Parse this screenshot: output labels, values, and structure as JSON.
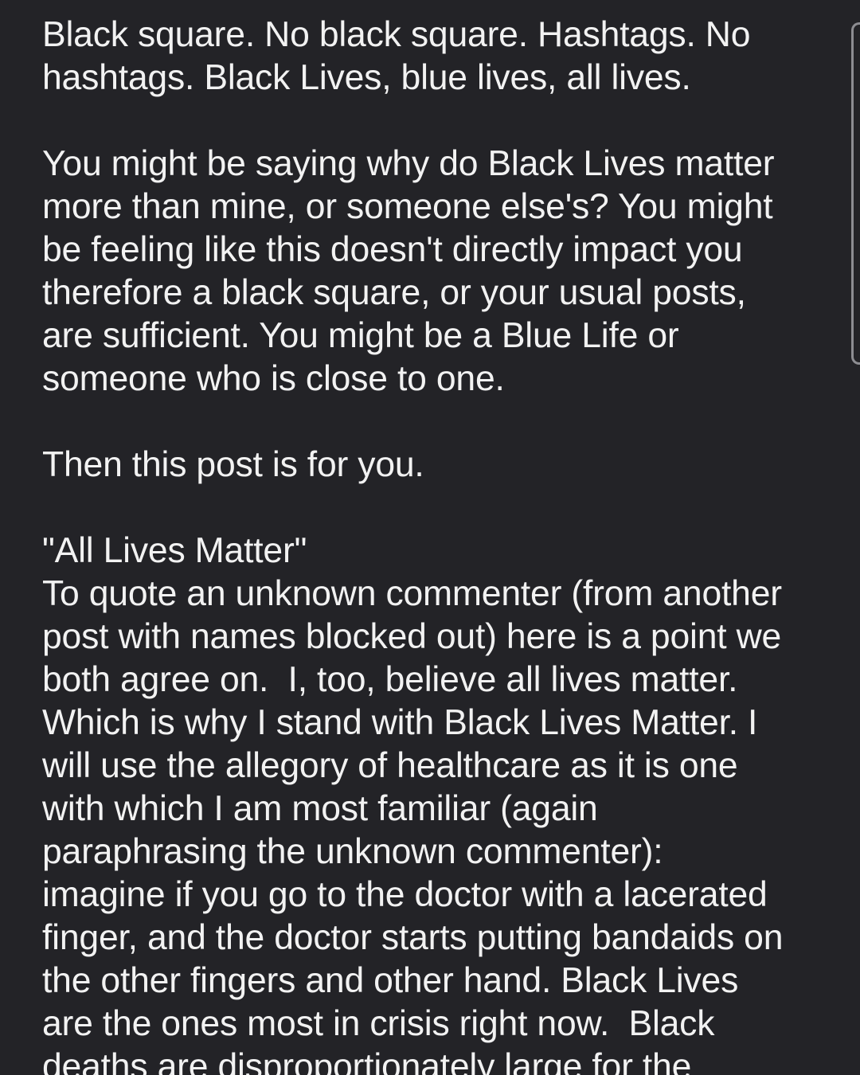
{
  "post": {
    "paragraphs": [
      {
        "lines": [
          "Black square. No black square. Hashtags. No",
          "hashtags. Black Lives, blue lives, all lives."
        ]
      },
      {
        "lines": [
          "You might be saying why do Black Lives matter",
          "more than mine, or someone else's? You might",
          "be feeling like this doesn't directly impact you",
          "therefore a black square, or your usual posts,",
          "are sufficient. You might be a Blue Life or",
          "someone who is close to one."
        ]
      },
      {
        "lines": [
          "Then this post is for you."
        ]
      },
      {
        "lines": [
          "\"All Lives Matter\"",
          "To quote an unknown commenter (from another",
          "post with names blocked out) here is a point we",
          "both agree on.  I, too, believe all lives matter.",
          "Which is why I stand with Black Lives Matter. I",
          "will use the allegory of healthcare as it is one",
          "with which I am most familiar (again",
          "paraphrasing the unknown commenter):",
          "imagine if you go to the doctor with a lacerated",
          "finger, and the doctor starts putting bandaids on",
          "the other fingers and other hand. Black Lives",
          "are the ones most in crisis right now.  Black",
          "deaths are disproportionately large for the"
        ]
      }
    ]
  }
}
